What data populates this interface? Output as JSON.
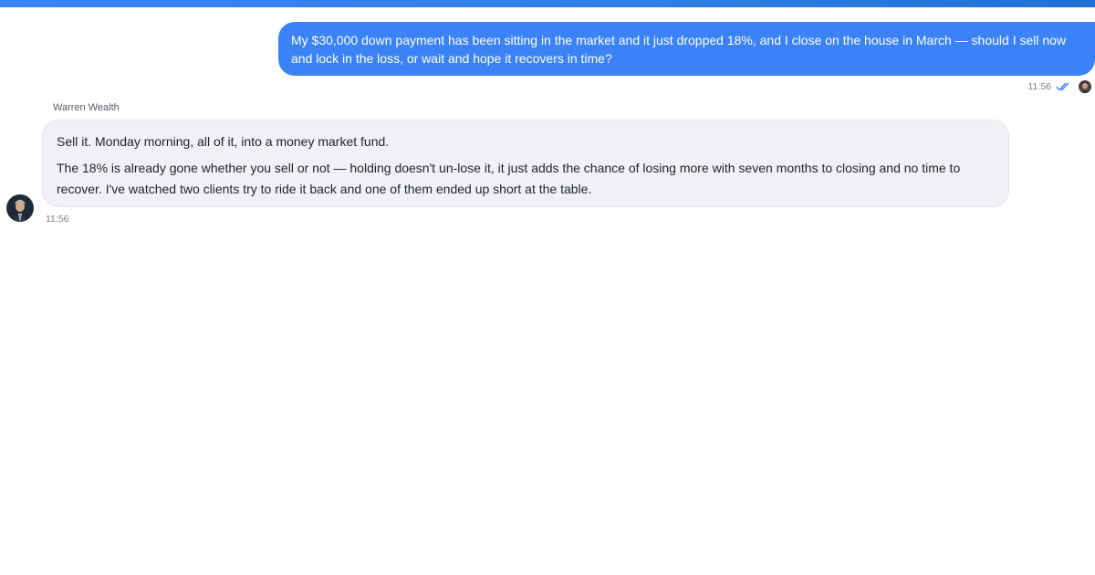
{
  "conversation": {
    "user_message": {
      "text": "My $30,000 down payment has been sitting in the market and it just dropped 18%, and I close on the house in March — should I sell now and lock in the loss, or wait and hope it recovers in time?",
      "time": "11:56",
      "status_icon": "double-check-icon",
      "avatar_icon": "user-avatar"
    },
    "assistant_message": {
      "sender": "Warren Wealth",
      "paragraph_1": "Sell it. Monday morning, all of it, into a money market fund.",
      "paragraph_2": "The 18% is already gone whether you sell or not — holding doesn't un-lose it, it just adds the chance of losing more with seven months to closing and no time to recover. I've watched two clients try to ride it back and one of them ended up short at the table.",
      "time": "11:56",
      "avatar_icon": "advisor-avatar"
    }
  },
  "colors": {
    "accent": "#3b82f6",
    "assistant_bubble": "#f0f1f4",
    "read_receipt": "#3b82f6"
  }
}
